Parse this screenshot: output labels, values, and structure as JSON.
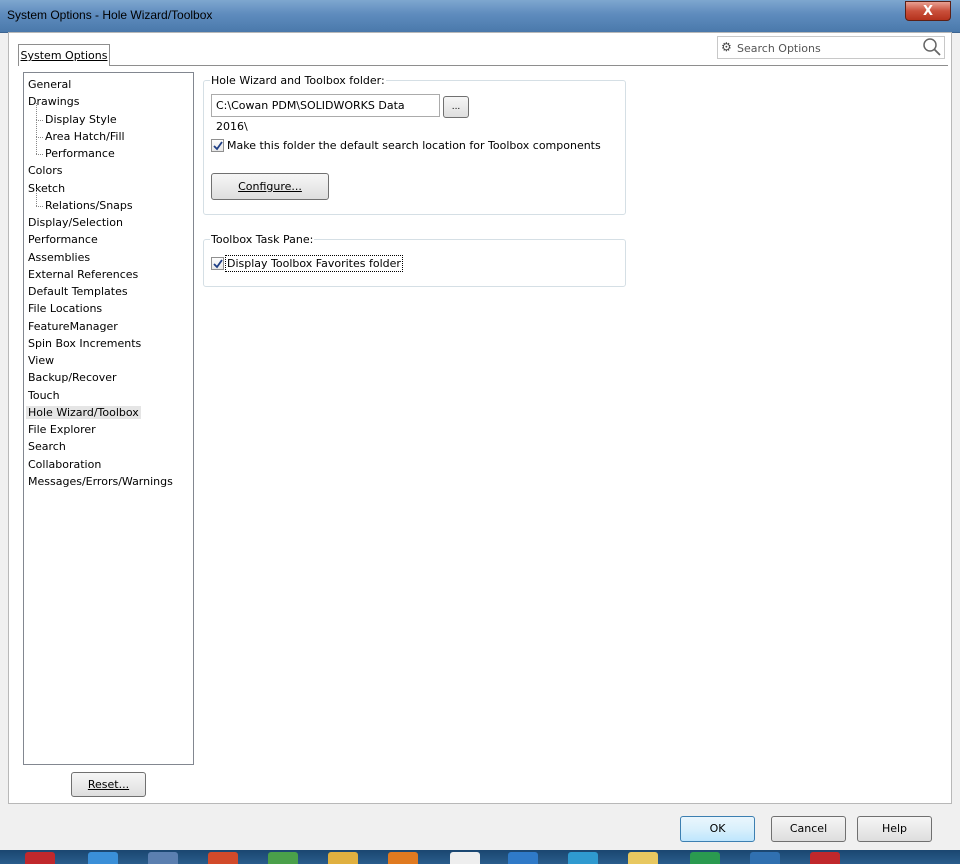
{
  "window": {
    "title": "System Options - Hole Wizard/Toolbox",
    "close_label": "X"
  },
  "tabs": [
    {
      "label": "System Options",
      "selected": true
    }
  ],
  "search": {
    "placeholder": "Search Options",
    "icons": [
      "gear-icon",
      "magnifier-icon"
    ]
  },
  "tree": {
    "items": [
      {
        "label": "General",
        "level": 0
      },
      {
        "label": "Drawings",
        "level": 0
      },
      {
        "label": "Display Style",
        "level": 1
      },
      {
        "label": "Area Hatch/Fill",
        "level": 1
      },
      {
        "label": "Performance",
        "level": 1
      },
      {
        "label": "Colors",
        "level": 0
      },
      {
        "label": "Sketch",
        "level": 0
      },
      {
        "label": "Relations/Snaps",
        "level": 1
      },
      {
        "label": "Display/Selection",
        "level": 0
      },
      {
        "label": "Performance",
        "level": 0
      },
      {
        "label": "Assemblies",
        "level": 0
      },
      {
        "label": "External References",
        "level": 0
      },
      {
        "label": "Default Templates",
        "level": 0
      },
      {
        "label": "File Locations",
        "level": 0
      },
      {
        "label": "FeatureManager",
        "level": 0
      },
      {
        "label": "Spin Box Increments",
        "level": 0
      },
      {
        "label": "View",
        "level": 0
      },
      {
        "label": "Backup/Recover",
        "level": 0
      },
      {
        "label": "Touch",
        "level": 0
      },
      {
        "label": "Hole Wizard/Toolbox",
        "level": 0,
        "selected": true
      },
      {
        "label": "File Explorer",
        "level": 0
      },
      {
        "label": "Search",
        "level": 0
      },
      {
        "label": "Collaboration",
        "level": 0
      },
      {
        "label": "Messages/Errors/Warnings",
        "level": 0
      }
    ],
    "reset_label": "Reset..."
  },
  "toolbox_folder": {
    "group_label": "Hole Wizard and Toolbox folder:",
    "path_value": "C:\\Cowan PDM\\SOLIDWORKS Data 2016\\",
    "browse_label": "...",
    "default_search_checkbox": {
      "label": "Make this folder the default search location for Toolbox components",
      "checked": true
    },
    "configure_label": "Configure..."
  },
  "task_pane": {
    "group_label": "Toolbox Task Pane:",
    "favorites_checkbox": {
      "label": "Display Toolbox Favorites folder",
      "checked": true
    }
  },
  "footer": {
    "ok_label": "OK",
    "cancel_label": "Cancel",
    "help_label": "Help"
  },
  "taskbar": {
    "icons": [
      "solidworks-icon",
      "internet-explorer-icon",
      "window-icon",
      "chrome-icon",
      "app-icon",
      "folder-icon",
      "firefox-icon",
      "app-icon",
      "app-icon",
      "app-icon",
      "folder-icon",
      "app-icon",
      "app-icon",
      "solidworks-icon"
    ]
  },
  "colors": {
    "title_bar": "#5e8bbd",
    "close_button": "#c9503b",
    "primary_button_border": "#3c7fb1"
  }
}
